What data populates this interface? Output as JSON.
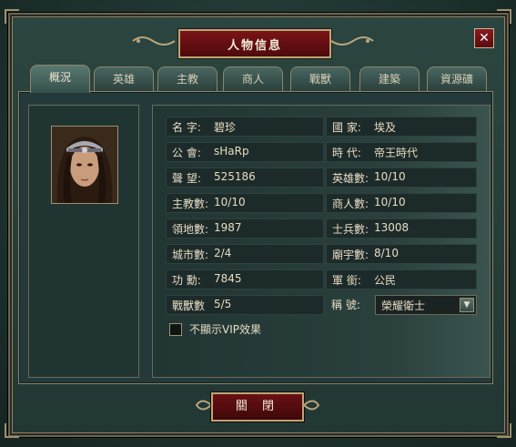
{
  "dialog": {
    "title": "人物信息",
    "close_glyph": "✕",
    "close_button_label": "關 閉"
  },
  "tabs": [
    {
      "label": "概況",
      "active": true
    },
    {
      "label": "英雄",
      "active": false
    },
    {
      "label": "主教",
      "active": false
    },
    {
      "label": "商人",
      "active": false
    },
    {
      "label": "戰獸",
      "active": false
    },
    {
      "label": "建築",
      "active": false
    },
    {
      "label": "資源礦",
      "active": false
    }
  ],
  "info": {
    "rows": [
      {
        "l_label": "名 字:",
        "l_value": "碧珍",
        "r_label": "國 家:",
        "r_value": "埃及"
      },
      {
        "l_label": "公 會:",
        "l_value": "sHaRp",
        "r_label": "時 代:",
        "r_value": "帝王時代"
      },
      {
        "l_label": "聲 望:",
        "l_value": "525186",
        "r_label": "英雄數:",
        "r_value": "10/10"
      },
      {
        "l_label": "主教數:",
        "l_value": "10/10",
        "r_label": "商人數:",
        "r_value": "10/10"
      },
      {
        "l_label": "領地數:",
        "l_value": "1987",
        "r_label": "士兵數:",
        "r_value": "13008"
      },
      {
        "l_label": "城市數:",
        "l_value": "2/4",
        "r_label": "廟宇數:",
        "r_value": "8/10"
      },
      {
        "l_label": "功 勳:",
        "l_value": "7845",
        "r_label": "軍 銜:",
        "r_value": "公民"
      }
    ],
    "last_row": {
      "l_label": "戰獸數",
      "l_value": "5/5",
      "r_label": "稱 號:",
      "title_select": "榮耀衛士"
    },
    "vip_checkbox_label": "不顯示VIP效果",
    "vip_checked": false
  },
  "icons": {
    "close": "close-icon",
    "dropdown": "chevron-down-icon",
    "portrait": "character-portrait"
  }
}
